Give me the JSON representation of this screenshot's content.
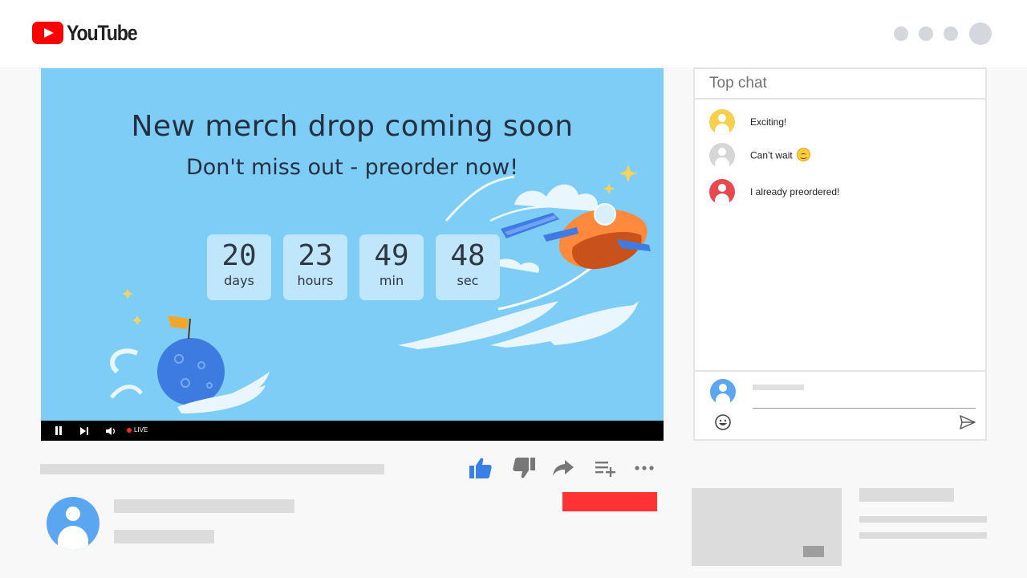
{
  "app": {
    "logo_text": "YouTube",
    "brand_color": "#ff0000"
  },
  "header": {
    "dots": [
      "menu-dot",
      "menu-dot",
      "menu-dot",
      "account-avatar"
    ]
  },
  "video": {
    "headline": "New merch drop coming soon",
    "subline": "Don't miss out - preorder now!",
    "background_color": "#7ecdf7",
    "countdown": [
      {
        "value": "20",
        "unit": "days"
      },
      {
        "value": "23",
        "unit": "hours"
      },
      {
        "value": "49",
        "unit": "min"
      },
      {
        "value": "48",
        "unit": "sec"
      }
    ],
    "controls": {
      "live_label": "LIVE",
      "icons": [
        "pause-icon",
        "next-icon",
        "volume-icon"
      ]
    }
  },
  "chat": {
    "title": "Top chat",
    "messages": [
      {
        "text": "Exciting!",
        "avatar_color": "#f6d04d"
      },
      {
        "text": "Can’t wait",
        "avatar_color": "#d6d6d6",
        "emoji": "smiling-face-emoji"
      },
      {
        "text": "I already preordered!",
        "avatar_color": "#e8474f"
      }
    ],
    "composer": {
      "avatar_color": "#5ba6f0",
      "icons": [
        "emoji-icon",
        "send-icon"
      ]
    }
  },
  "actions": {
    "icons": [
      "like-icon",
      "dislike-icon",
      "share-icon",
      "add-to-playlist-icon",
      "more-icon"
    ],
    "like_active_color": "#3a7ee8",
    "subscribe_color": "#ff3333"
  }
}
